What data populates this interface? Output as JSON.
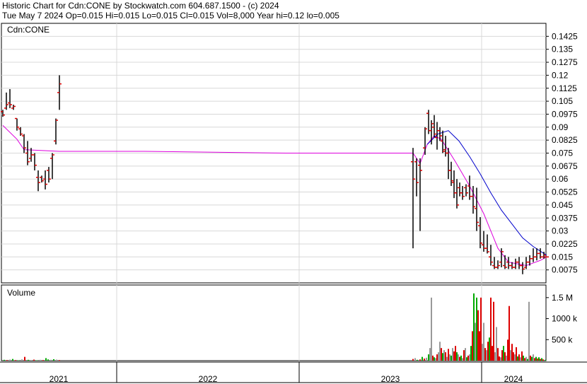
{
  "header": {
    "line1": "Historic Chart for Cdn:CONE by Stockwatch.com 604.687.1500 - (c) 2024",
    "line2": "Tue May  7 2024  Op=0.015  Hi=0.015  Lo=0.015  Cl=0.015  Vol=8,000  Year hi=0.12  lo=0.005"
  },
  "chart_data": {
    "type": "ohlc",
    "symbol_label": "Cdn:CONE",
    "volume_label": "Volume",
    "price_ticks": [
      "0.1425",
      "0.135",
      "0.1275",
      "0.12",
      "0.1125",
      "0.105",
      "0.0975",
      "0.09",
      "0.0825",
      "0.075",
      "0.0675",
      "0.06",
      "0.0525",
      "0.045",
      "0.0375",
      "0.03",
      "0.0225",
      "0.015",
      "0.0075"
    ],
    "price_tick_values": [
      0.1425,
      0.135,
      0.1275,
      0.12,
      0.1125,
      0.105,
      0.0975,
      0.09,
      0.0825,
      0.075,
      0.0675,
      0.06,
      0.0525,
      0.045,
      0.0375,
      0.03,
      0.0225,
      0.015,
      0.0075
    ],
    "volume_ticks": [
      "1.5 M",
      "1000 k",
      "500 k"
    ],
    "volume_tick_values": [
      1500000,
      1000000,
      500000
    ],
    "years": [
      "2021",
      "2022",
      "2023",
      "2024"
    ],
    "colors": {
      "ma_short": "#dd00dd",
      "ma_long": "#0000cc",
      "up": "#00aa00",
      "down": "#dd0000",
      "neutral": "#999999",
      "price": "#000000"
    },
    "ma_short": [
      [
        0,
        0.091
      ],
      [
        20,
        0.083
      ],
      [
        30,
        0.077
      ],
      [
        80,
        0.076
      ],
      [
        200,
        0.076
      ],
      [
        400,
        0.075
      ],
      [
        580,
        0.075
      ],
      [
        590,
        0.069
      ],
      [
        600,
        0.08
      ],
      [
        610,
        0.085
      ],
      [
        620,
        0.083
      ],
      [
        640,
        0.07
      ],
      [
        660,
        0.056
      ],
      [
        680,
        0.04
      ],
      [
        690,
        0.03
      ],
      [
        700,
        0.02
      ],
      [
        715,
        0.012
      ],
      [
        740,
        0.01
      ],
      [
        760,
        0.013
      ],
      [
        769,
        0.015
      ]
    ],
    "ma_long": [
      [
        600,
        0.08
      ],
      [
        615,
        0.086
      ],
      [
        630,
        0.088
      ],
      [
        645,
        0.082
      ],
      [
        660,
        0.073
      ],
      [
        675,
        0.063
      ],
      [
        690,
        0.052
      ],
      [
        705,
        0.042
      ],
      [
        720,
        0.034
      ],
      [
        735,
        0.026
      ],
      [
        750,
        0.021
      ],
      [
        765,
        0.017
      ],
      [
        769,
        0.016
      ]
    ],
    "bars": [
      [
        0,
        0.1,
        0.096,
        0.099,
        0.097
      ],
      [
        5,
        0.11,
        0.1,
        0.101,
        0.103
      ],
      [
        10,
        0.112,
        0.101,
        0.104,
        0.103
      ],
      [
        15,
        0.103,
        0.1,
        0.101,
        0.102
      ],
      [
        20,
        0.095,
        0.088,
        0.095,
        0.09
      ],
      [
        25,
        0.09,
        0.085,
        0.089,
        0.086
      ],
      [
        30,
        0.086,
        0.075,
        0.085,
        0.078
      ],
      [
        35,
        0.082,
        0.068,
        0.075,
        0.07
      ],
      [
        40,
        0.078,
        0.07,
        0.072,
        0.074
      ],
      [
        45,
        0.075,
        0.065,
        0.074,
        0.068
      ],
      [
        50,
        0.065,
        0.053,
        0.061,
        0.058
      ],
      [
        55,
        0.062,
        0.058,
        0.061,
        0.059
      ],
      [
        60,
        0.065,
        0.054,
        0.06,
        0.057
      ],
      [
        65,
        0.067,
        0.058,
        0.065,
        0.06
      ],
      [
        70,
        0.075,
        0.06,
        0.072,
        0.074
      ],
      [
        75,
        0.095,
        0.08,
        0.082,
        0.094
      ],
      [
        80,
        0.12,
        0.1,
        0.11,
        0.115
      ],
      [
        580,
        0.078,
        0.02,
        0.07,
        0.06
      ],
      [
        585,
        0.072,
        0.05,
        0.07,
        0.058
      ],
      [
        590,
        0.072,
        0.03,
        0.068,
        0.065
      ],
      [
        597,
        0.09,
        0.074,
        0.078,
        0.089
      ],
      [
        602,
        0.1,
        0.086,
        0.098,
        0.088
      ],
      [
        606,
        0.094,
        0.08,
        0.088,
        0.092
      ],
      [
        610,
        0.097,
        0.084,
        0.09,
        0.086
      ],
      [
        614,
        0.093,
        0.077,
        0.084,
        0.088
      ],
      [
        618,
        0.09,
        0.082,
        0.088,
        0.085
      ],
      [
        622,
        0.088,
        0.075,
        0.082,
        0.076
      ],
      [
        626,
        0.085,
        0.073,
        0.077,
        0.075
      ],
      [
        630,
        0.078,
        0.06,
        0.075,
        0.065
      ],
      [
        634,
        0.07,
        0.056,
        0.065,
        0.059
      ],
      [
        638,
        0.065,
        0.049,
        0.058,
        0.052
      ],
      [
        642,
        0.06,
        0.043,
        0.052,
        0.045
      ],
      [
        646,
        0.058,
        0.05,
        0.055,
        0.052
      ],
      [
        650,
        0.056,
        0.048,
        0.052,
        0.05
      ],
      [
        655,
        0.057,
        0.05,
        0.055,
        0.052
      ],
      [
        660,
        0.062,
        0.048,
        0.056,
        0.05
      ],
      [
        665,
        0.056,
        0.04,
        0.05,
        0.044
      ],
      [
        670,
        0.055,
        0.03,
        0.043,
        0.035
      ],
      [
        675,
        0.038,
        0.02,
        0.033,
        0.023
      ],
      [
        680,
        0.03,
        0.018,
        0.022,
        0.02
      ],
      [
        685,
        0.028,
        0.017,
        0.02,
        0.018
      ],
      [
        690,
        0.022,
        0.01,
        0.015,
        0.012
      ],
      [
        695,
        0.015,
        0.008,
        0.01,
        0.009
      ],
      [
        700,
        0.013,
        0.008,
        0.009,
        0.01
      ],
      [
        705,
        0.02,
        0.009,
        0.012,
        0.018
      ],
      [
        710,
        0.016,
        0.008,
        0.01,
        0.009
      ],
      [
        715,
        0.015,
        0.008,
        0.012,
        0.01
      ],
      [
        720,
        0.012,
        0.008,
        0.01,
        0.009
      ],
      [
        725,
        0.014,
        0.008,
        0.009,
        0.012
      ],
      [
        730,
        0.015,
        0.008,
        0.012,
        0.01
      ],
      [
        735,
        0.012,
        0.005,
        0.01,
        0.008
      ],
      [
        740,
        0.015,
        0.008,
        0.009,
        0.012
      ],
      [
        745,
        0.016,
        0.01,
        0.012,
        0.014
      ],
      [
        750,
        0.02,
        0.012,
        0.014,
        0.015
      ],
      [
        755,
        0.02,
        0.013,
        0.015,
        0.017
      ],
      [
        760,
        0.02,
        0.014,
        0.017,
        0.015
      ],
      [
        765,
        0.018,
        0.014,
        0.015,
        0.016
      ],
      [
        769,
        0.015,
        0.015,
        0.015,
        0.015
      ]
    ],
    "volumes": [
      [
        2,
        20000,
        "g"
      ],
      [
        6,
        15000,
        "r"
      ],
      [
        10,
        25000,
        "k"
      ],
      [
        14,
        40000,
        "g"
      ],
      [
        18,
        15000,
        "r"
      ],
      [
        22,
        10000,
        "g"
      ],
      [
        27,
        30000,
        "k"
      ],
      [
        31,
        90000,
        "r"
      ],
      [
        36,
        20000,
        "g"
      ],
      [
        40,
        15000,
        "k"
      ],
      [
        44,
        25000,
        "r"
      ],
      [
        48,
        10000,
        "g"
      ],
      [
        53,
        20000,
        "k"
      ],
      [
        57,
        15000,
        "r"
      ],
      [
        61,
        60000,
        "g"
      ],
      [
        64,
        30000,
        "g"
      ],
      [
        68,
        20000,
        "k"
      ],
      [
        72,
        35000,
        "g"
      ],
      [
        76,
        25000,
        "k"
      ],
      [
        80,
        15000,
        "r"
      ],
      [
        580,
        40000,
        "r"
      ],
      [
        583,
        60000,
        "k"
      ],
      [
        586,
        20000,
        "g"
      ],
      [
        590,
        30000,
        "r"
      ],
      [
        593,
        90000,
        "g"
      ],
      [
        596,
        50000,
        "r"
      ],
      [
        599,
        70000,
        "k"
      ],
      [
        602,
        150000,
        "g"
      ],
      [
        604,
        300000,
        "k"
      ],
      [
        606,
        1500000,
        "k"
      ],
      [
        608,
        120000,
        "r"
      ],
      [
        610,
        80000,
        "g"
      ],
      [
        612,
        60000,
        "k"
      ],
      [
        614,
        150000,
        "r"
      ],
      [
        616,
        200000,
        "k"
      ],
      [
        618,
        450000,
        "k"
      ],
      [
        620,
        300000,
        "r"
      ],
      [
        622,
        180000,
        "g"
      ],
      [
        624,
        250000,
        "k"
      ],
      [
        626,
        200000,
        "r"
      ],
      [
        628,
        90000,
        "k"
      ],
      [
        630,
        280000,
        "r"
      ],
      [
        632,
        150000,
        "k"
      ],
      [
        634,
        120000,
        "g"
      ],
      [
        636,
        300000,
        "k"
      ],
      [
        638,
        220000,
        "r"
      ],
      [
        640,
        350000,
        "r"
      ],
      [
        642,
        200000,
        "g"
      ],
      [
        644,
        150000,
        "k"
      ],
      [
        646,
        90000,
        "r"
      ],
      [
        648,
        120000,
        "g"
      ],
      [
        650,
        60000,
        "k"
      ],
      [
        652,
        250000,
        "r"
      ],
      [
        654,
        300000,
        "k"
      ],
      [
        656,
        80000,
        "g"
      ],
      [
        658,
        120000,
        "r"
      ],
      [
        660,
        150000,
        "k"
      ],
      [
        662,
        350000,
        "g"
      ],
      [
        664,
        700000,
        "r"
      ],
      [
        666,
        1600000,
        "g"
      ],
      [
        668,
        900000,
        "k"
      ],
      [
        670,
        1500000,
        "g"
      ],
      [
        672,
        1200000,
        "r"
      ],
      [
        674,
        700000,
        "r"
      ],
      [
        676,
        1500000,
        "r"
      ],
      [
        678,
        400000,
        "k"
      ],
      [
        680,
        900000,
        "k"
      ],
      [
        682,
        300000,
        "r"
      ],
      [
        684,
        250000,
        "k"
      ],
      [
        686,
        450000,
        "r"
      ],
      [
        688,
        550000,
        "g"
      ],
      [
        690,
        1500000,
        "r"
      ],
      [
        692,
        350000,
        "r"
      ],
      [
        694,
        1400000,
        "r"
      ],
      [
        696,
        200000,
        "k"
      ],
      [
        698,
        800000,
        "k"
      ],
      [
        700,
        300000,
        "r"
      ],
      [
        702,
        100000,
        "r"
      ],
      [
        704,
        80000,
        "k"
      ],
      [
        706,
        250000,
        "r"
      ],
      [
        708,
        350000,
        "g"
      ],
      [
        710,
        200000,
        "r"
      ],
      [
        712,
        120000,
        "k"
      ],
      [
        714,
        500000,
        "r"
      ],
      [
        716,
        1300000,
        "r"
      ],
      [
        718,
        250000,
        "k"
      ],
      [
        720,
        400000,
        "r"
      ],
      [
        722,
        200000,
        "r"
      ],
      [
        724,
        150000,
        "k"
      ],
      [
        726,
        320000,
        "r"
      ],
      [
        728,
        100000,
        "g"
      ],
      [
        730,
        150000,
        "r"
      ],
      [
        732,
        80000,
        "k"
      ],
      [
        734,
        220000,
        "r"
      ],
      [
        736,
        120000,
        "g"
      ],
      [
        738,
        60000,
        "r"
      ],
      [
        740,
        90000,
        "k"
      ],
      [
        742,
        40000,
        "g"
      ],
      [
        744,
        1400000,
        "k"
      ],
      [
        746,
        120000,
        "r"
      ],
      [
        748,
        90000,
        "g"
      ],
      [
        750,
        150000,
        "k"
      ],
      [
        752,
        60000,
        "r"
      ],
      [
        754,
        90000,
        "g"
      ],
      [
        756,
        50000,
        "r"
      ],
      [
        758,
        80000,
        "g"
      ],
      [
        760,
        40000,
        "r"
      ],
      [
        762,
        60000,
        "g"
      ],
      [
        764,
        30000,
        "r"
      ],
      [
        767,
        20000,
        "g"
      ]
    ]
  }
}
